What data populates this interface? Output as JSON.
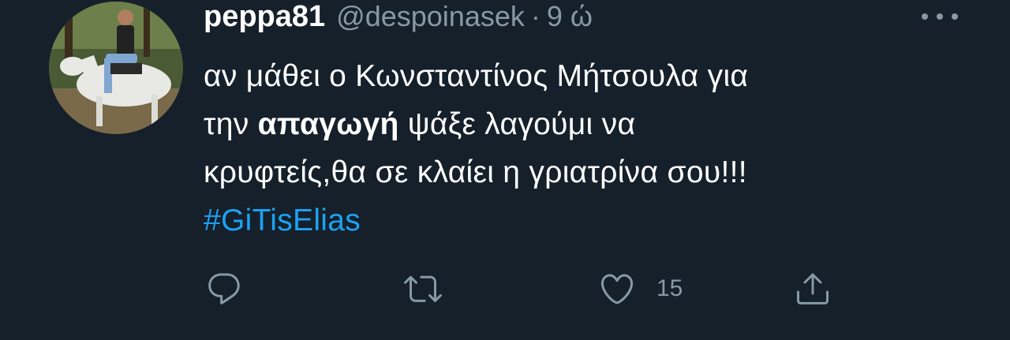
{
  "tweet": {
    "display_name": "peppa81",
    "handle": "@despoinasek",
    "separator": "·",
    "time": "9 ώ",
    "text_line1": "αν μάθει ο Κωνσταντίνος Μήτσουλα για",
    "text_line2_pre": "την ",
    "text_line2_bold": "απαγωγή",
    "text_line2_post": " ψάξε λαγούμι να",
    "text_line3": "κρυφτείς,θα σε κλαίει η γριατρίνα σου!!!",
    "hashtag": "#GiTisElias",
    "likes_count": "15"
  },
  "icons": {
    "reply": "reply-icon",
    "retweet": "retweet-icon",
    "like": "heart-icon",
    "share": "share-icon",
    "more": "more-icon"
  },
  "colors": {
    "background": "#15202b",
    "text": "#ffffff",
    "secondary": "#8899a6",
    "link": "#1da1f2"
  }
}
